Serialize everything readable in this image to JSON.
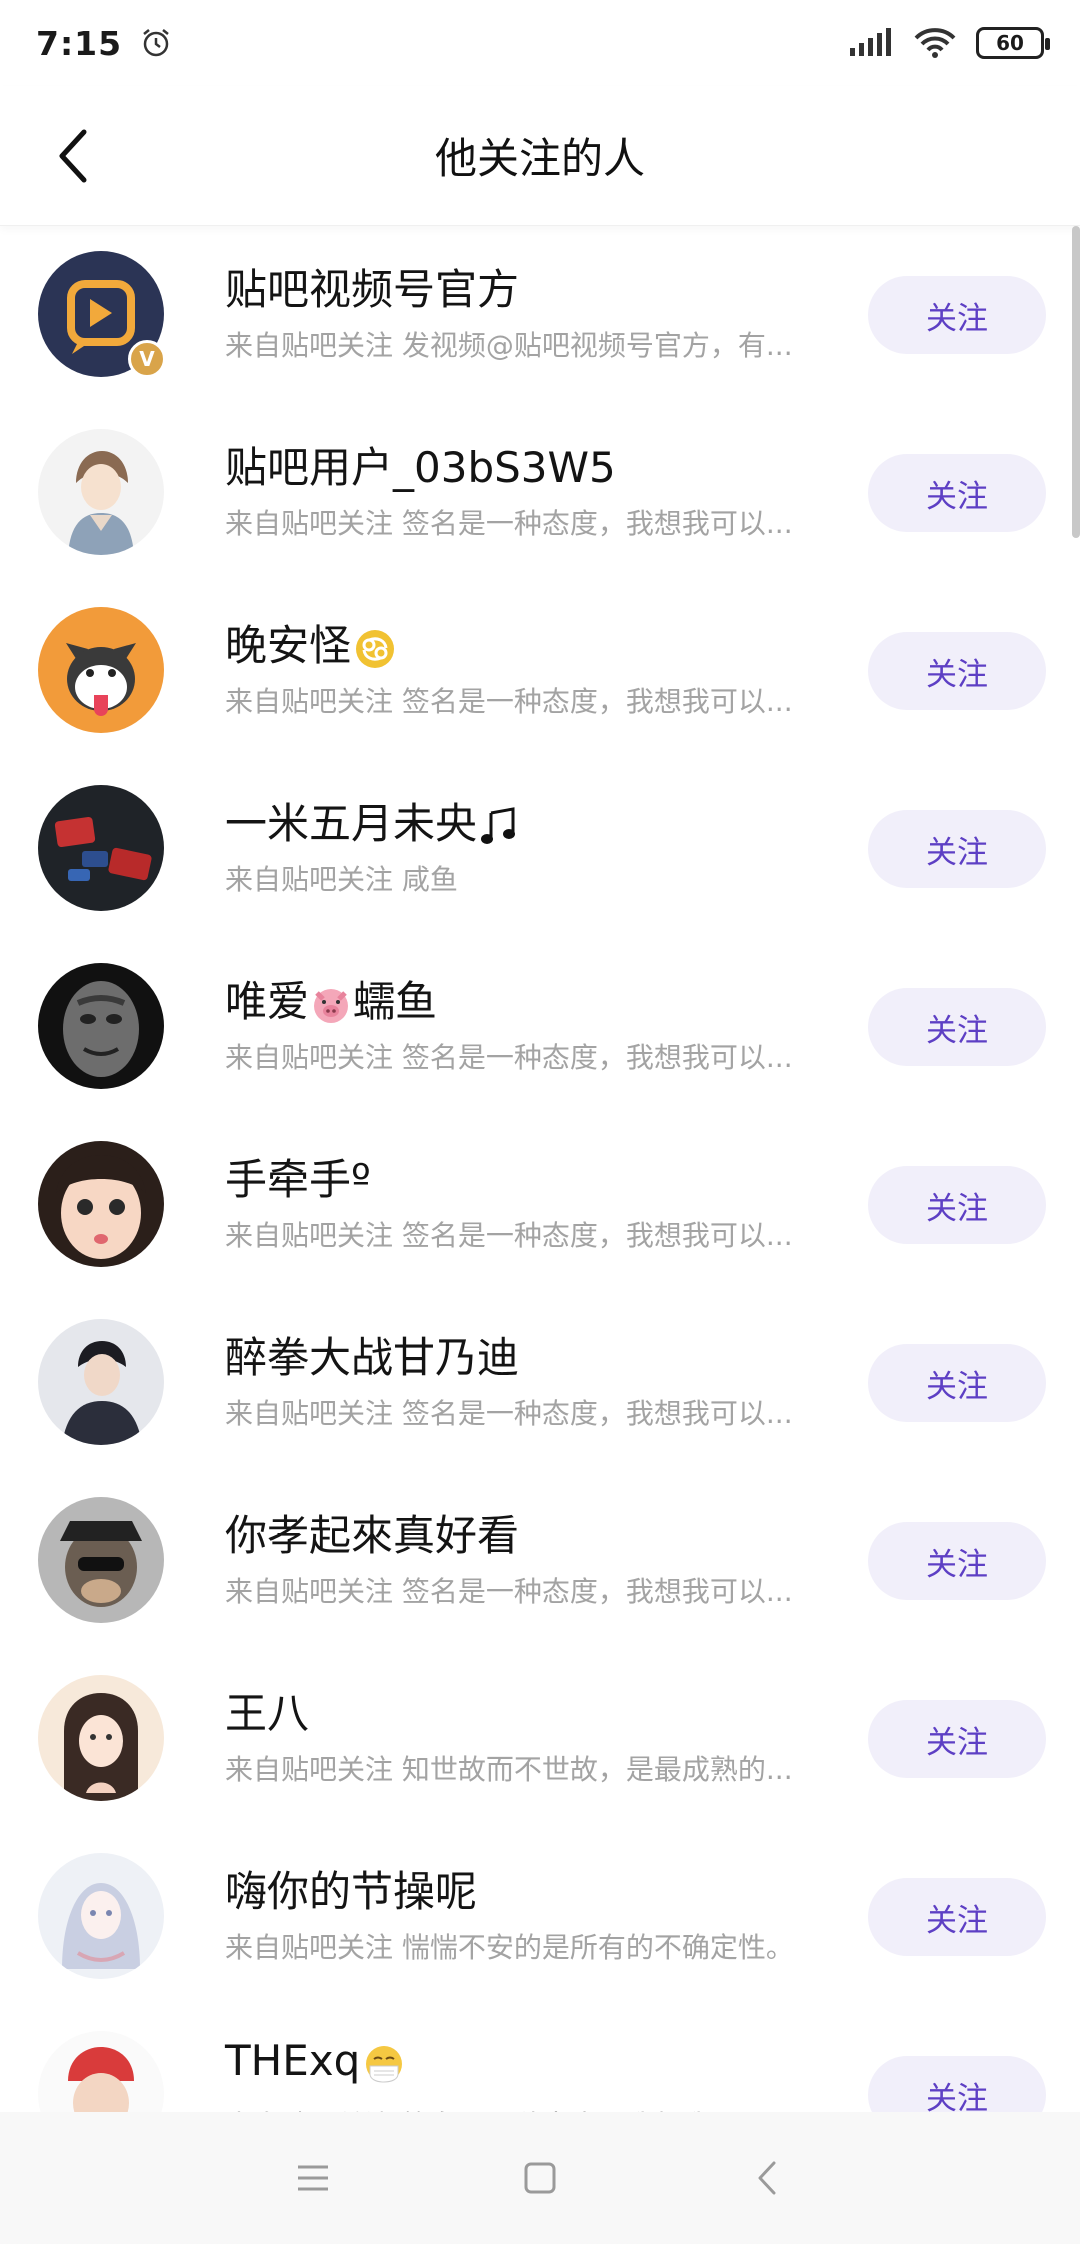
{
  "status": {
    "time": "7:15",
    "battery": "60"
  },
  "header": {
    "title": "他关注的人"
  },
  "follow_label": "关注",
  "users": [
    {
      "name": "贴吧视频号官方",
      "desc": "来自贴吧关注 发视频@贴吧视频号官方，有...",
      "avatar": "video-official-avatar",
      "verified": "V"
    },
    {
      "name": "贴吧用户_03bS3W5",
      "desc": "来自贴吧关注 签名是一种态度，我想我可以..."
    },
    {
      "name": "晚安怪",
      "desc": "来自贴吧关注 签名是一种态度，我想我可以...",
      "emoji": "cancer-emoji"
    },
    {
      "name": "一米五月未央",
      "desc": "来自贴吧关注 咸鱼",
      "emoji": "music-note-emoji"
    },
    {
      "name_a": "唯爱",
      "name_b": "蠕鱼",
      "desc": "来自贴吧关注 签名是一种态度，我想我可以...",
      "emoji": "pig-emoji"
    },
    {
      "name": "手牵手º",
      "desc": "来自贴吧关注 签名是一种态度，我想我可以..."
    },
    {
      "name": "醉拳大战甘乃迪",
      "desc": "来自贴吧关注 签名是一种态度，我想我可以..."
    },
    {
      "name": "你孝起來真好看",
      "desc": "来自贴吧关注 签名是一种态度，我想我可以..."
    },
    {
      "name": "王八",
      "desc": "来自贴吧关注 知世故而不世故，是最成熟的..."
    },
    {
      "name": "嗨你的节操呢",
      "desc": "来自贴吧关注 惴惴不安的是所有的不确定性。"
    },
    {
      "name": "THExq",
      "desc": "来自贴吧关注 签名是一种态度，我想我可以...",
      "emoji": "mask-face-emoji"
    }
  ]
}
